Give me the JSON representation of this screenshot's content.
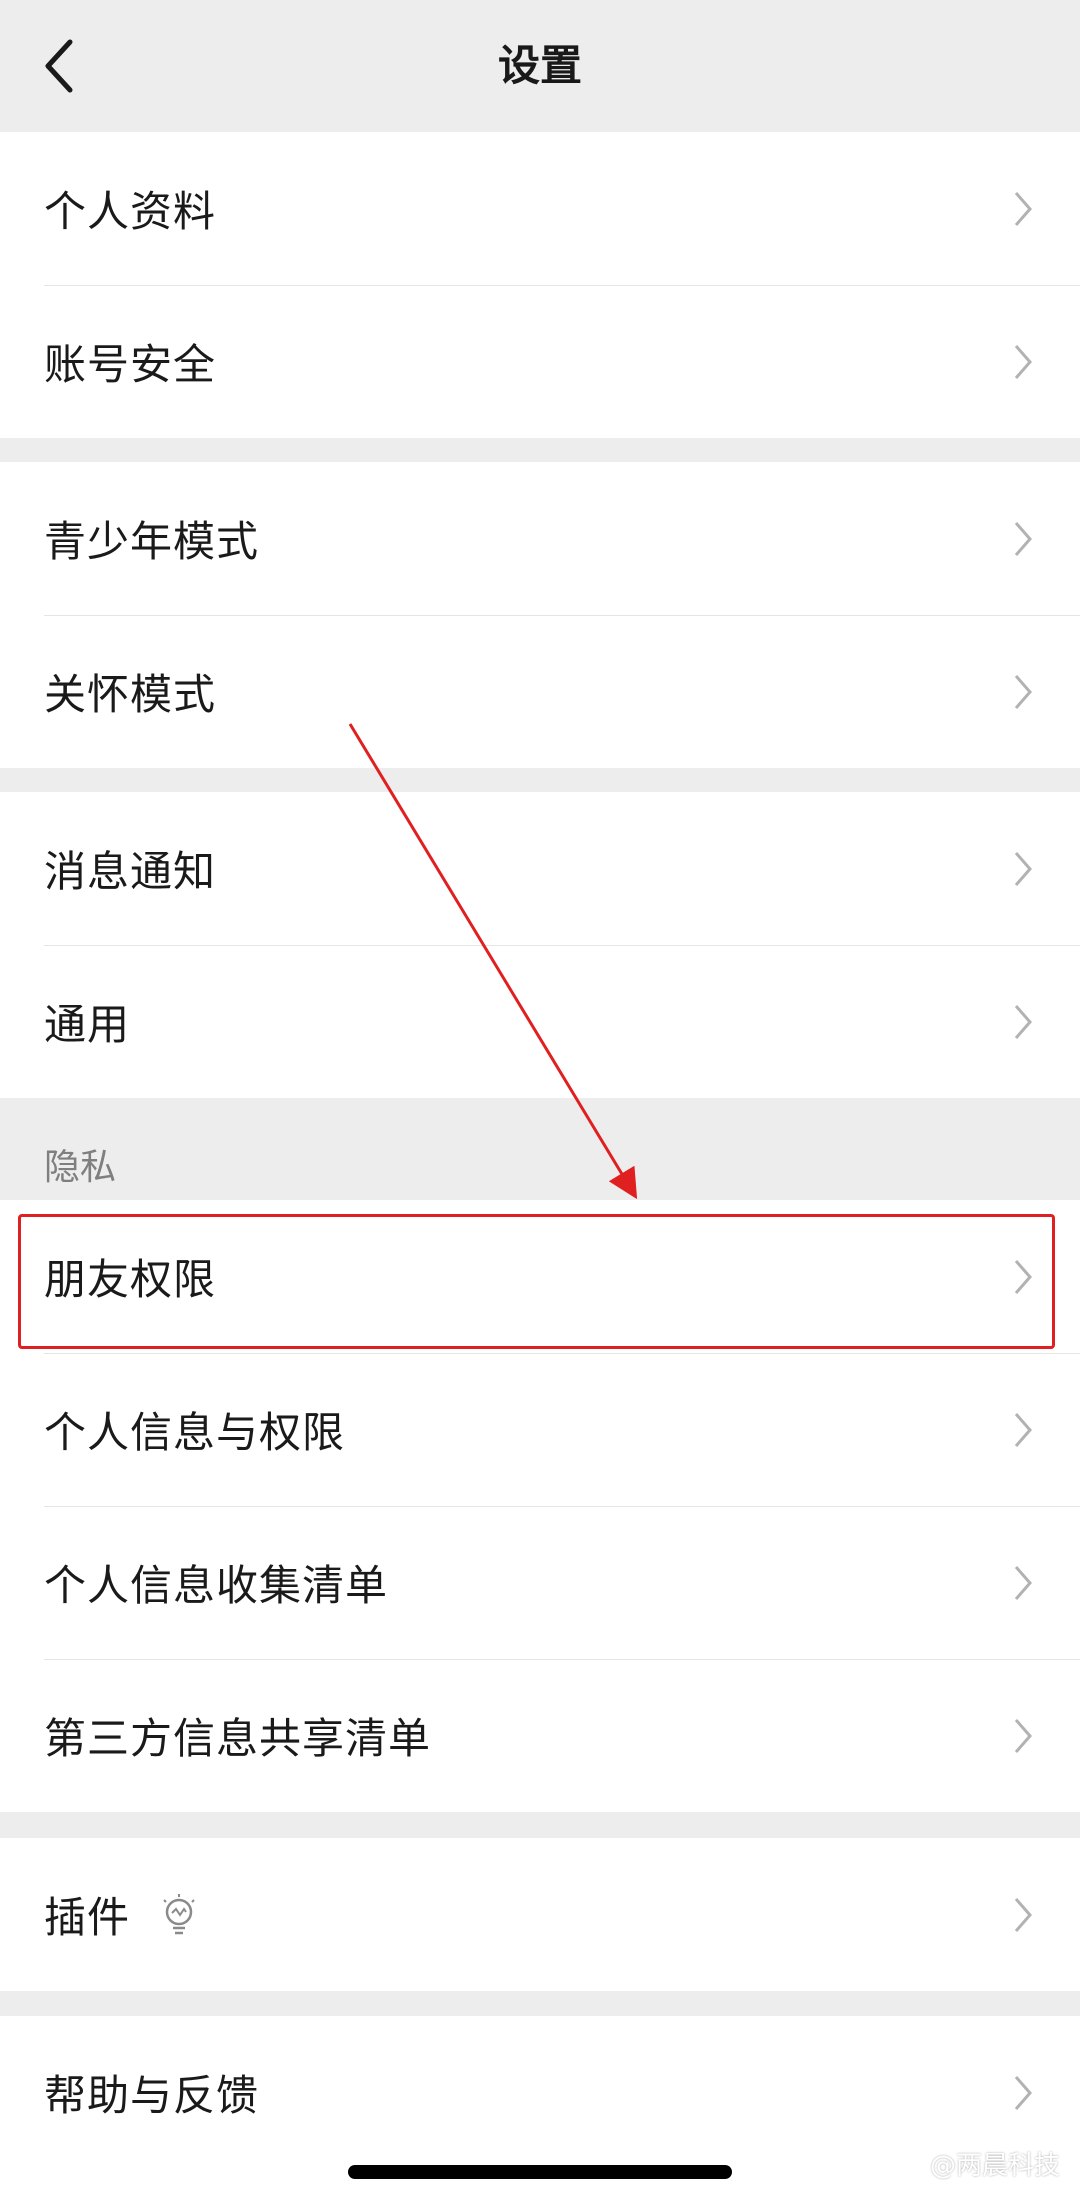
{
  "nav": {
    "title": "设置",
    "back_icon": "chevron-left-icon"
  },
  "group1": [
    "个人资料",
    "账号安全"
  ],
  "group2": [
    "青少年模式",
    "关怀模式"
  ],
  "group3": [
    "消息通知",
    "通用"
  ],
  "privacy": {
    "section_label": "隐私",
    "items": [
      "朋友权限",
      "个人信息与权限",
      "个人信息收集清单",
      "第三方信息共享清单"
    ]
  },
  "group5": {
    "plugins_label": "插件",
    "plugins_icon": "lightbulb-icon"
  },
  "group6": [
    "帮助与反馈"
  ],
  "annotation": {
    "highlight_color": "#e02020",
    "target_item": "朋友权限"
  },
  "watermark": "@两晨科技",
  "colors": {
    "background": "#ededed",
    "row": "#ffffff",
    "chevron": "#b2b2b2",
    "section_label": "#7f7f7f"
  }
}
